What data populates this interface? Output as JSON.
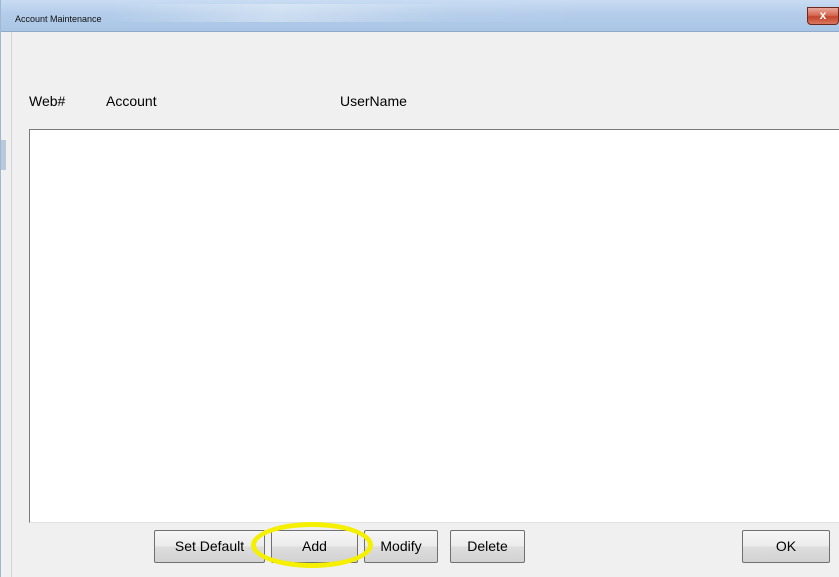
{
  "window": {
    "title": "Account Maintenance",
    "close_symbol": "x"
  },
  "list": {
    "columns": [
      "Web#",
      "Account",
      "UserName"
    ],
    "rows": []
  },
  "buttons": {
    "set_default": "Set Default",
    "add": "Add",
    "modify": "Modify",
    "delete": "Delete",
    "ok": "OK"
  },
  "annotation": {
    "highlight_target": "Add",
    "highlight_color": "#f5f000"
  },
  "colors": {
    "desktop": "#3a78c8",
    "titlebar": "#b4cdea",
    "window_bg": "#f0f0f0",
    "close_button": "#c1442c"
  }
}
